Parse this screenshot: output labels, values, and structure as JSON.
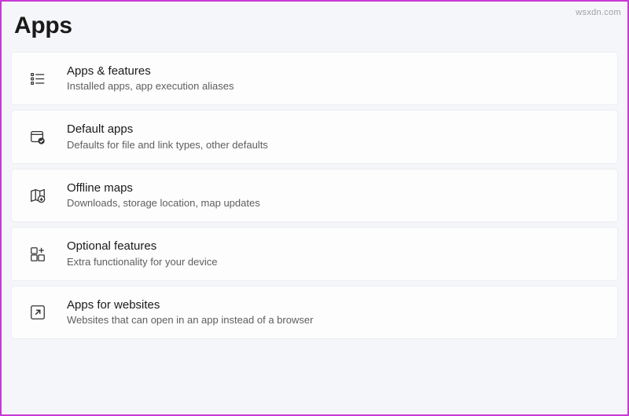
{
  "page": {
    "title": "Apps",
    "watermark": "wsxdn.com"
  },
  "settings": [
    {
      "icon": "list-icon",
      "title": "Apps & features",
      "description": "Installed apps, app execution aliases"
    },
    {
      "icon": "default-apps-icon",
      "title": "Default apps",
      "description": "Defaults for file and link types, other defaults"
    },
    {
      "icon": "offline-maps-icon",
      "title": "Offline maps",
      "description": "Downloads, storage location, map updates"
    },
    {
      "icon": "optional-features-icon",
      "title": "Optional features",
      "description": "Extra functionality for your device"
    },
    {
      "icon": "apps-websites-icon",
      "title": "Apps for websites",
      "description": "Websites that can open in an app instead of a browser"
    }
  ]
}
